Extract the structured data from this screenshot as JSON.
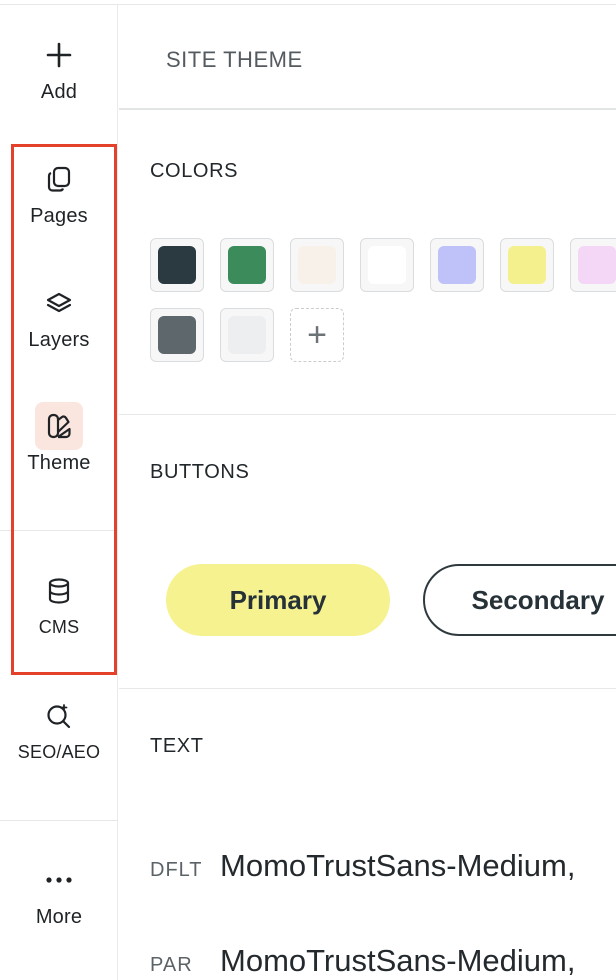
{
  "sidebar": {
    "items": [
      {
        "label": "Add",
        "icon": "plus-icon"
      },
      {
        "label": "Pages",
        "icon": "pages-icon"
      },
      {
        "label": "Layers",
        "icon": "layers-icon"
      },
      {
        "label": "Theme",
        "icon": "theme-icon",
        "active": true
      },
      {
        "label": "CMS",
        "icon": "database-icon"
      },
      {
        "label": "SEO/AEO",
        "icon": "seo-search-sparkle-icon"
      },
      {
        "label": "More",
        "icon": "more-dots-icon"
      }
    ],
    "active_bg": "#fbe6df",
    "highlight_color": "#e4412b"
  },
  "panel": {
    "title": "SITE THEME",
    "colors": {
      "label": "COLORS",
      "swatches": [
        "#2b3a40",
        "#3c8b5b",
        "#f8f1ea",
        "#ffffff",
        "#bfc2f8",
        "#f4f08d",
        "#f4d6f6",
        "#5d676c",
        "#eceef0"
      ],
      "add_label": "+"
    },
    "buttons": {
      "label": "BUTTONS",
      "primary": "Primary",
      "secondary": "Secondary",
      "primary_color": "#f5f28f"
    },
    "text": {
      "label": "TEXT",
      "rows": [
        {
          "tag": "DFLT",
          "font": "MomoTrustSans-Medium,"
        },
        {
          "tag": "PAR",
          "font": "MomoTrustSans-Medium,"
        }
      ]
    }
  }
}
